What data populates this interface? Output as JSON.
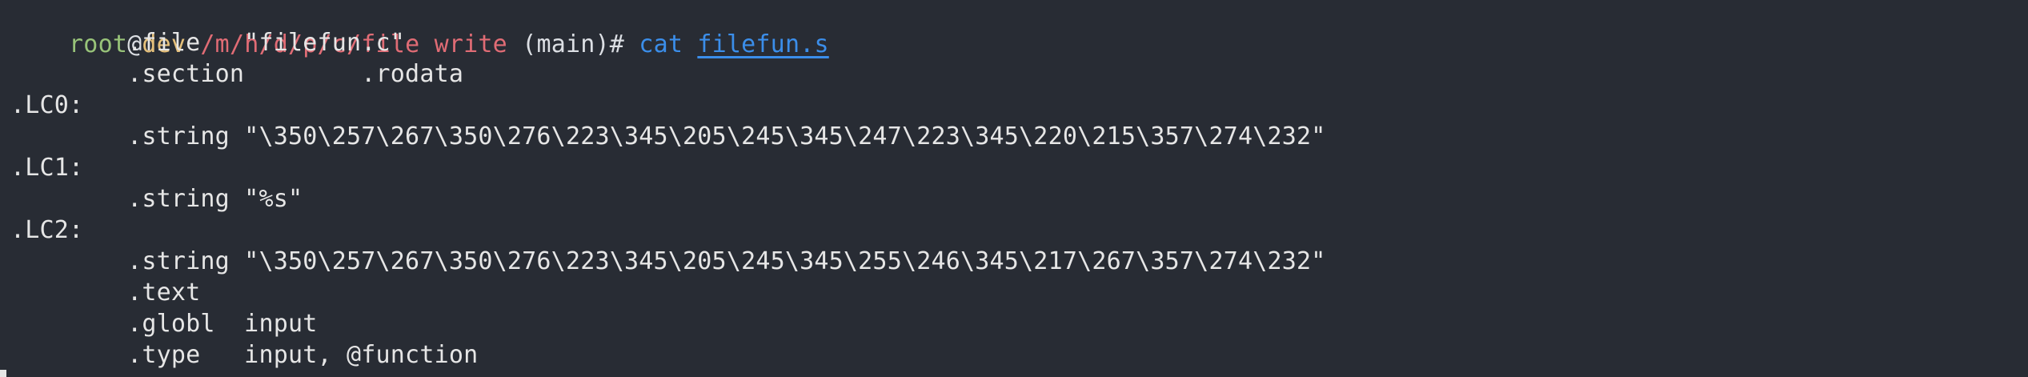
{
  "colors": {
    "background": "#282c34",
    "text": "#e6e6e6",
    "prompt_user": "#98c379",
    "prompt_host": "#e5c07b",
    "prompt_path": "#e06c75",
    "command": "#3b8eea"
  },
  "prompt": {
    "user": "root",
    "at": "@",
    "host": "dev",
    "path": "/m/h/d/p/c/file",
    "branch_word": "write",
    "branch": "(main)",
    "symbol": "#",
    "command": "cat",
    "argument": "filefun.s"
  },
  "output_lines": [
    "        .file   \"filefun.c\"",
    "        .section        .rodata",
    ".LC0:",
    "        .string \"\\350\\257\\267\\350\\276\\223\\345\\205\\245\\345\\247\\223\\345\\220\\215\\357\\274\\232\"",
    ".LC1:",
    "        .string \"%s\"",
    ".LC2:",
    "        .string \"\\350\\257\\267\\350\\276\\223\\345\\205\\245\\345\\255\\246\\345\\217\\267\\357\\274\\232\"",
    "        .text",
    "        .globl  input",
    "        .type   input, @function"
  ]
}
